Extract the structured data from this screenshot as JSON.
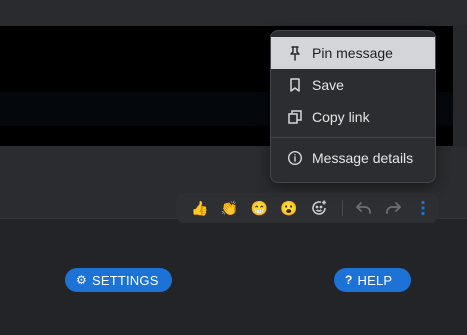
{
  "menu": {
    "items": [
      {
        "label": "Pin message",
        "icon": "pin-icon"
      },
      {
        "label": "Save",
        "icon": "bookmark-icon"
      },
      {
        "label": "Copy link",
        "icon": "copy-icon"
      },
      {
        "label": "Message details",
        "icon": "info-icon"
      }
    ]
  },
  "reactions": {
    "emojis": [
      "👍",
      "👏",
      "😁",
      "😮"
    ]
  },
  "footer": {
    "settings_label": "SETTINGS",
    "help_label": "HELP",
    "help_icon": "?",
    "settings_icon": "⚙"
  },
  "colors": {
    "accent": "#1d72d6",
    "menu_bg": "#2c2d30",
    "selected_bg": "#d4d5d8"
  }
}
